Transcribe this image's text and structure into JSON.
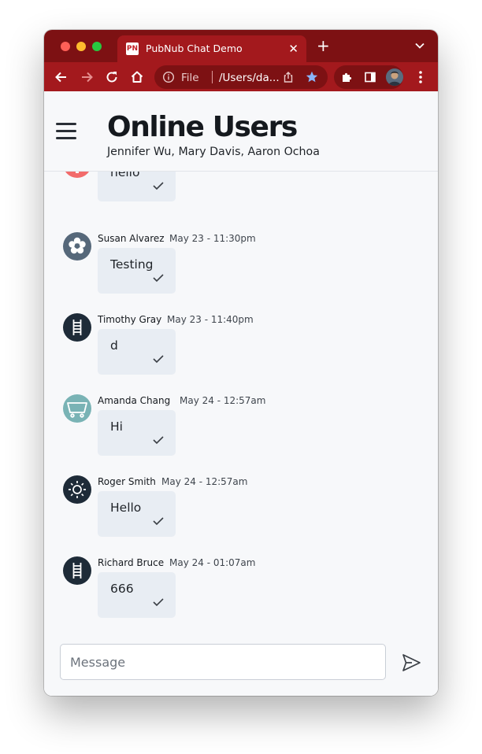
{
  "browser": {
    "tab_favicon": "PN",
    "tab_title": "PubNub Chat Demo",
    "url_scheme": "File",
    "url_text": "/Users/da...",
    "colors": {
      "tab_strip": "#7d1113",
      "toolbar": "#a3191d"
    }
  },
  "header": {
    "title": "Online Users",
    "subtitle": "Jennifer Wu, Mary Davis, Aaron Ochoa"
  },
  "partial_message": {
    "text": "hello",
    "avatar_color": "#f26b6b"
  },
  "messages": [
    {
      "name": "Susan Alvarez",
      "time": "May 23 - 11:30pm",
      "text": "Testing",
      "avatar_icon": "flower-icon",
      "avatar_color": "#56687a"
    },
    {
      "name": "Timothy Gray",
      "time": "May 23 - 11:40pm",
      "text": "d",
      "avatar_icon": "ladder-icon",
      "avatar_color": "#1e2b38"
    },
    {
      "name": "Amanda Chang",
      "time": "May 24 - 12:57am",
      "text": "Hi",
      "avatar_icon": "cart-icon",
      "avatar_color": "#79b3b5"
    },
    {
      "name": "Roger Smith",
      "time": "May 24 - 12:57am",
      "text": "Hello",
      "avatar_icon": "sun-icon",
      "avatar_color": "#1e2b38"
    },
    {
      "name": "Richard Bruce",
      "time": "May 24 - 01:07am",
      "text": "666",
      "avatar_icon": "ladder-icon",
      "avatar_color": "#1e2b38"
    }
  ],
  "composer": {
    "placeholder": "Message",
    "value": ""
  }
}
